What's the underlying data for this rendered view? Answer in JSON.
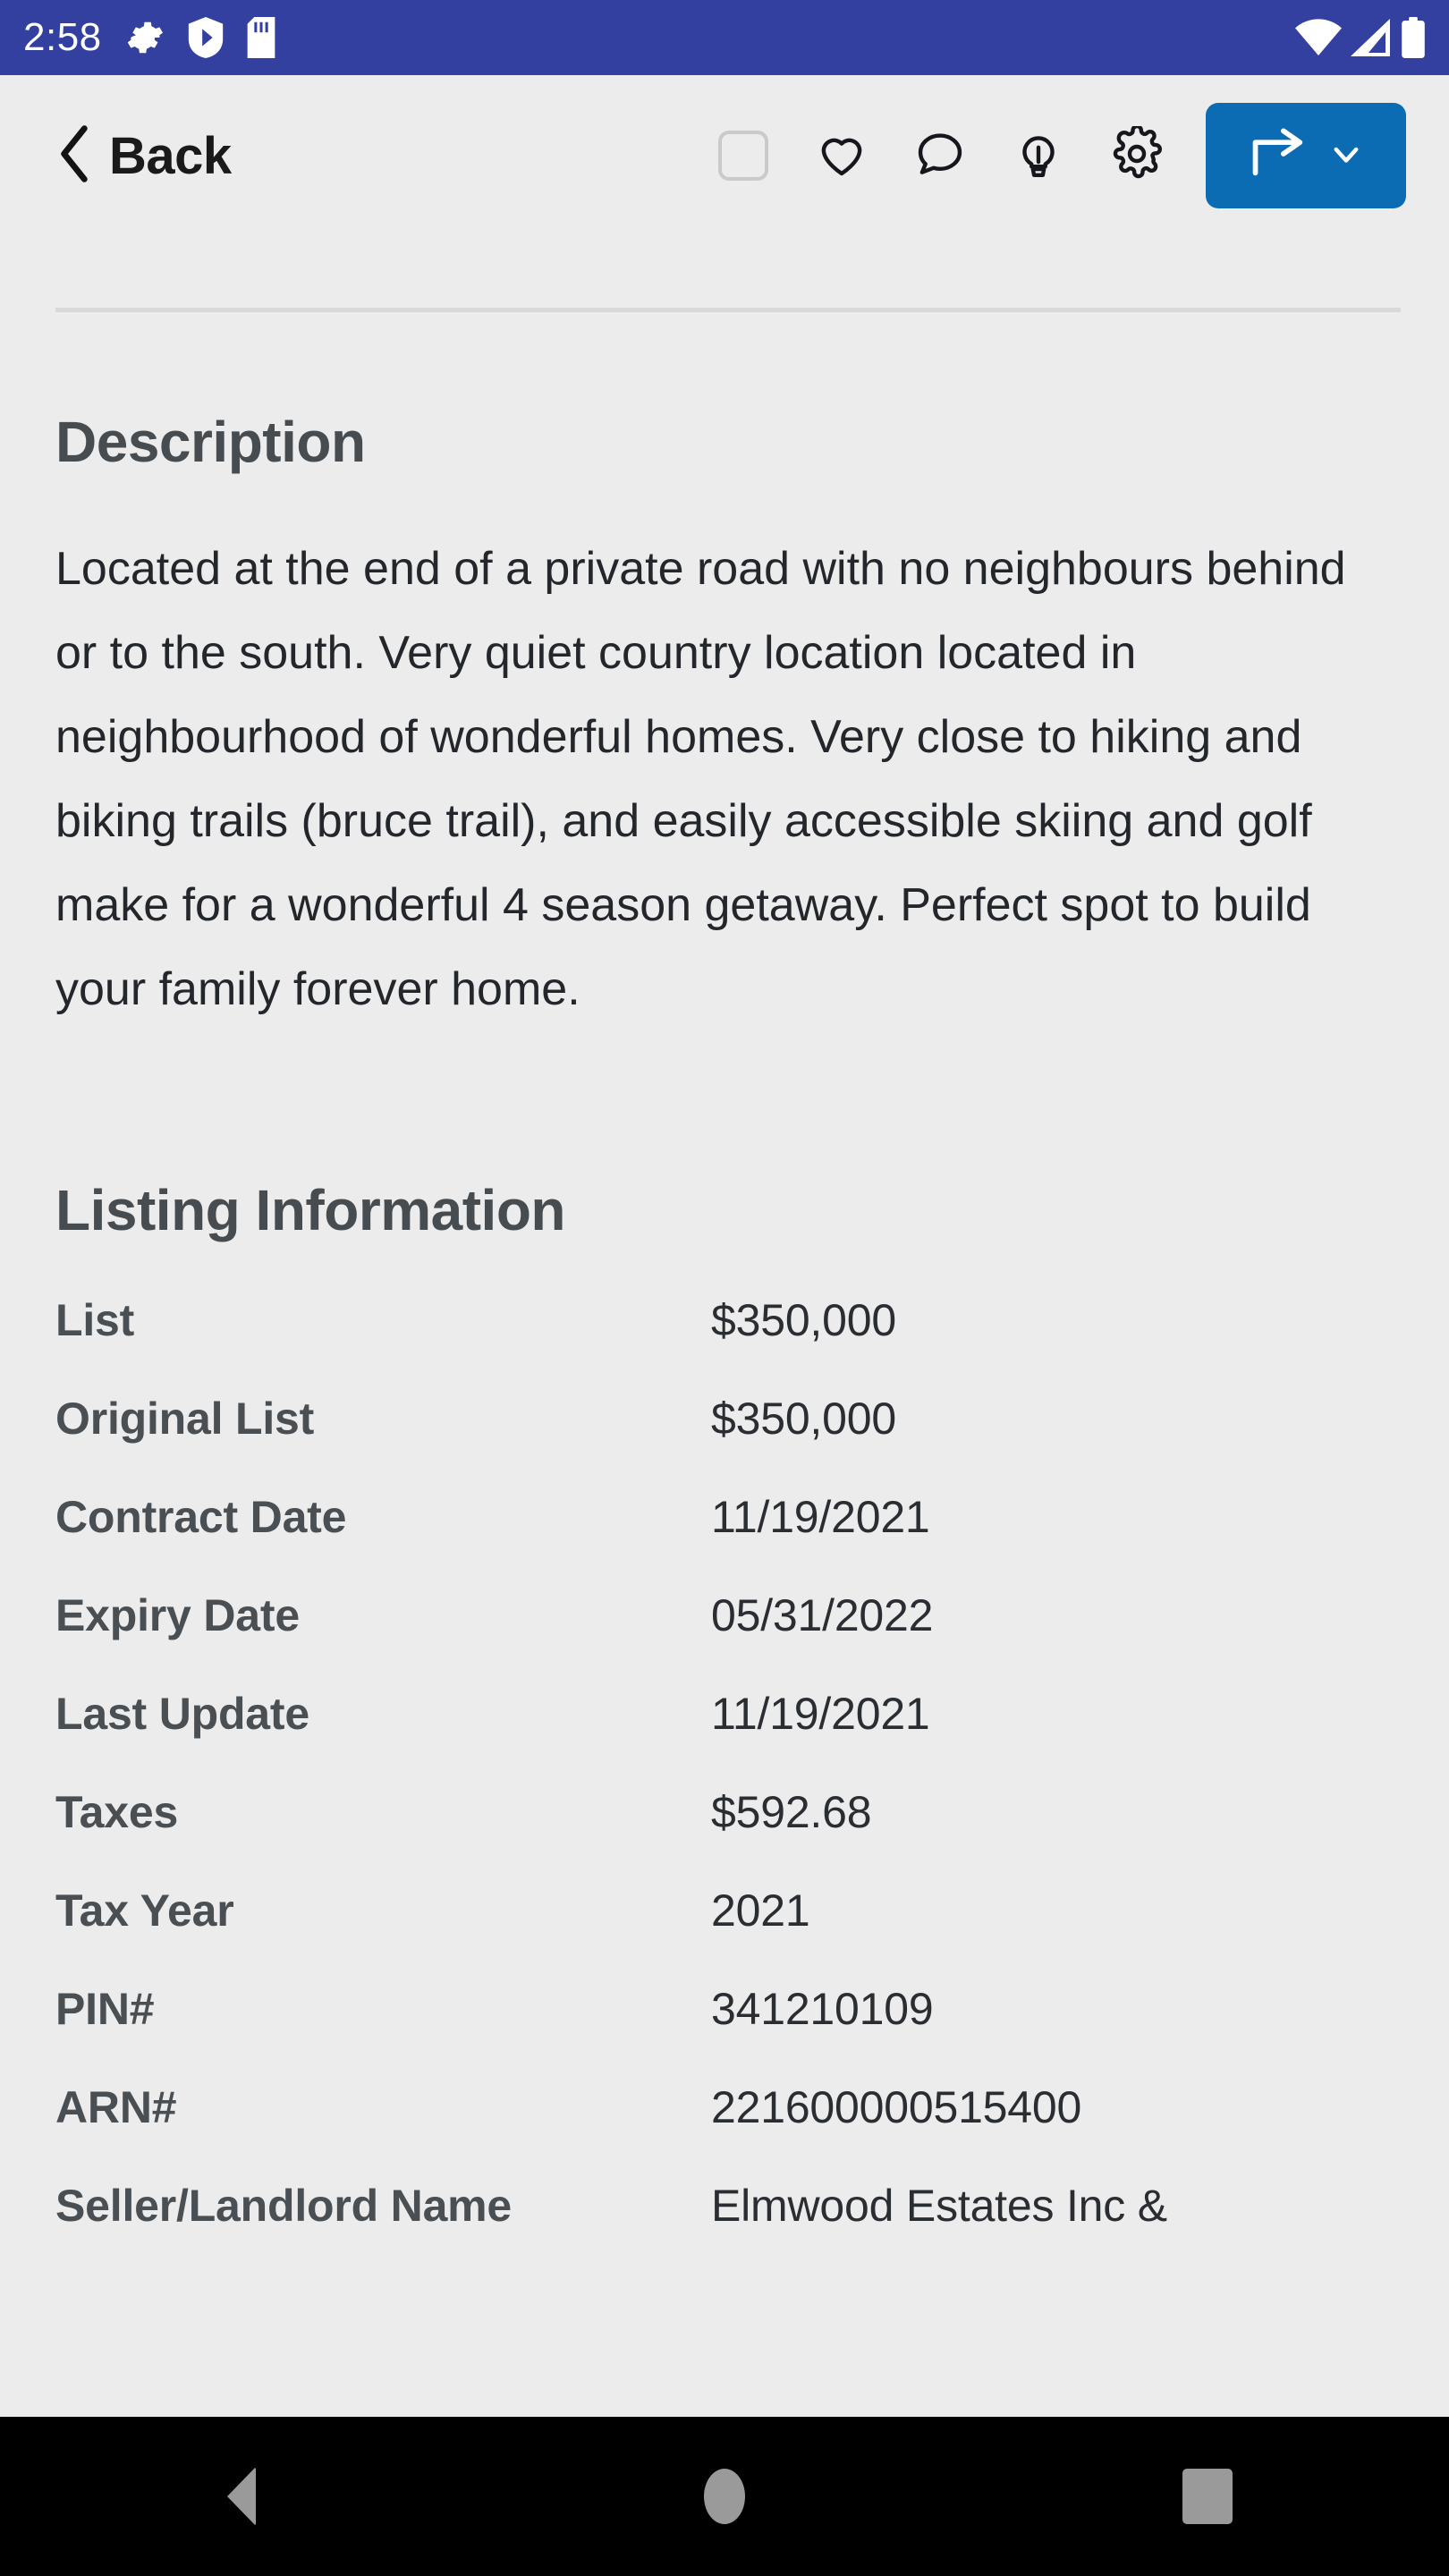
{
  "status_bar": {
    "time": "2:58",
    "left_icons": [
      "gear-icon",
      "shield-icon",
      "sd-card-icon"
    ],
    "right_icons": [
      "wifi-icon",
      "cellular-signal-icon",
      "battery-icon"
    ],
    "background_color": "#3340a0"
  },
  "toolbar": {
    "back_label": "Back",
    "back_icon": "chevron-left-icon",
    "actions": [
      {
        "name": "select-checkbox",
        "icon": "checkbox-unchecked-icon",
        "checked": false
      },
      {
        "name": "favorite-button",
        "icon": "heart-icon"
      },
      {
        "name": "comment-button",
        "icon": "comment-bubble-icon"
      },
      {
        "name": "tips-button",
        "icon": "lightbulb-icon"
      },
      {
        "name": "settings-button",
        "icon": "gear-icon"
      }
    ],
    "share_button": {
      "icon": "share-arrow-icon",
      "dropdown_icon": "chevron-down-icon",
      "background_color": "#0b6cb4"
    }
  },
  "description": {
    "title": "Description",
    "body": "Located at the end of a private road with no neighbours behind or to the south. Very quiet country location located in neighbourhood of wonderful homes. Very close to hiking and biking trails (bruce trail), and easily accessible skiing and golf make for a wonderful 4 season getaway. Perfect spot to build your family forever home."
  },
  "listing_information": {
    "title": "Listing Information",
    "rows": [
      {
        "label": "List",
        "value": "$350,000"
      },
      {
        "label": "Original List",
        "value": "$350,000"
      },
      {
        "label": "Contract Date",
        "value": "11/19/2021"
      },
      {
        "label": "Expiry Date",
        "value": "05/31/2022"
      },
      {
        "label": "Last Update",
        "value": "11/19/2021"
      },
      {
        "label": "Taxes",
        "value": "$592.68"
      },
      {
        "label": "Tax Year",
        "value": "2021"
      },
      {
        "label": "PIN#",
        "value": "341210109"
      },
      {
        "label": "ARN#",
        "value": "221600000515400"
      },
      {
        "label": "Seller/Landlord Name",
        "value": "Elmwood Estates Inc &"
      }
    ]
  },
  "nav_bar": {
    "buttons": [
      {
        "name": "android-back-button",
        "icon": "triangle-back-icon"
      },
      {
        "name": "android-home-button",
        "icon": "circle-home-icon"
      },
      {
        "name": "android-recents-button",
        "icon": "square-recents-icon"
      }
    ]
  }
}
